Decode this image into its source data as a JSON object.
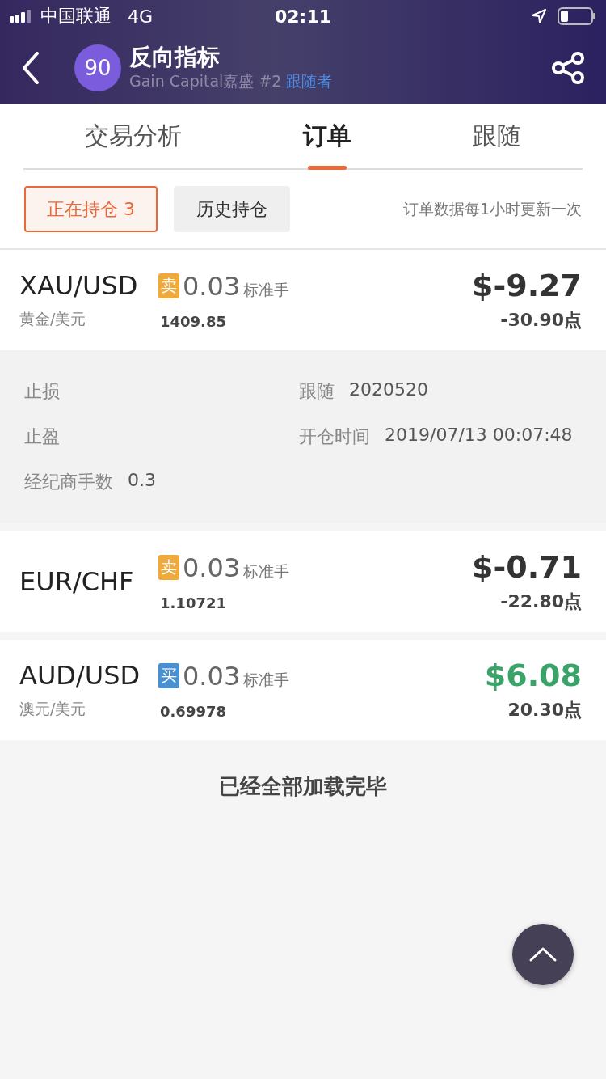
{
  "status_bar": {
    "carrier": "中国联通",
    "network": "4G",
    "time": "02:11"
  },
  "header": {
    "avatar": "90",
    "title": "反向指标",
    "subtitle": "Gain Capital嘉盛 #2",
    "tag": "跟随者"
  },
  "tabs": [
    {
      "label": "交易分析",
      "selected": false
    },
    {
      "label": "订单",
      "selected": true
    },
    {
      "label": "跟随",
      "selected": false
    }
  ],
  "filters": [
    {
      "label": "正在持仓 3",
      "selected": true
    },
    {
      "label": "历史持仓",
      "selected": false
    }
  ],
  "update_note": "订单数据每1小时更新一次",
  "orders": [
    {
      "symbol": "XAU/USD",
      "name": "黄金/美元",
      "kind": "sell",
      "side_label": "卖",
      "lots": "0.03",
      "lot_unit": "标准手",
      "price": "1409.85",
      "profit": "$-9.27",
      "profitable": false,
      "points": "-30.90点",
      "details": [
        {
          "label": "止损"
        },
        {
          "label": "跟随",
          "value": "2020520"
        },
        {
          "label": "止盈"
        },
        {
          "label": "开仓时间",
          "value": "2019/07/13 00:07:48"
        },
        {
          "label": "经纪商手数",
          "value": "0.3"
        }
      ]
    },
    {
      "symbol": "EUR/CHF",
      "kind": "sell",
      "side_label": "卖",
      "lots": "0.03",
      "lot_unit": "标准手",
      "price": "1.10721",
      "profit": "$-0.71",
      "profitable": false,
      "points": "-22.80点"
    },
    {
      "symbol": "AUD/USD",
      "name": "澳元/美元",
      "kind": "buy",
      "side_label": "买",
      "lots": "0.03",
      "lot_unit": "标准手",
      "price": "0.69978",
      "profit": "$6.08",
      "profitable": true,
      "points": "20.30点"
    }
  ],
  "footer": "已经全部加载完毕"
}
